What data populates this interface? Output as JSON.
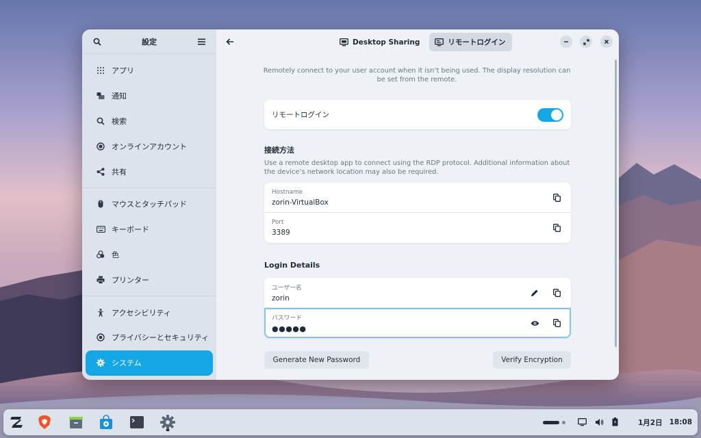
{
  "sidebar": {
    "title": "設定",
    "items": [
      {
        "label": "アプリ",
        "icon": "apps-grid-icon"
      },
      {
        "label": "通知",
        "icon": "notification-icon"
      },
      {
        "label": "検索",
        "icon": "search-icon"
      },
      {
        "label": "オンラインアカウント",
        "icon": "online-accounts-icon"
      },
      {
        "label": "共有",
        "icon": "share-icon"
      },
      {
        "label": "マウスとタッチパッド",
        "icon": "mouse-icon"
      },
      {
        "label": "キーボード",
        "icon": "keyboard-icon"
      },
      {
        "label": "色",
        "icon": "color-icon"
      },
      {
        "label": "プリンター",
        "icon": "printer-icon"
      },
      {
        "label": "アクセシビリティ",
        "icon": "accessibility-icon"
      },
      {
        "label": "プライバシーとセキュリティ",
        "icon": "privacy-icon"
      },
      {
        "label": "システム",
        "icon": "gear-icon",
        "active": true
      }
    ]
  },
  "header": {
    "tabs": [
      {
        "label": "Desktop Sharing",
        "icon": "desktop-sharing-icon"
      },
      {
        "label": "リモートログイン",
        "icon": "remote-login-icon",
        "active": true
      }
    ]
  },
  "main": {
    "description": "Remotely connect to your user account when it isn’t being used. The display resolution can be set from the remote.",
    "remote_login": {
      "label": "リモートログイン",
      "enabled": true
    },
    "connection": {
      "title": "接続方法",
      "description": "Use a remote desktop app to connect using the RDP protocol. Additional information about the device’s network location may also be required.",
      "hostname_label": "Hostname",
      "hostname": "zorin-VirtualBox",
      "port_label": "Port",
      "port": "3389"
    },
    "login": {
      "title": "Login Details",
      "username_label": "ユーザー名",
      "username": "zorin",
      "password_label": "パスワード",
      "password": "●●●●●"
    },
    "buttons": {
      "generate": "Generate New Password",
      "verify": "Verify Encryption"
    }
  },
  "taskbar": {
    "apps": [
      "zorin-menu-icon",
      "brave-browser-icon",
      "files-icon",
      "software-store-icon",
      "terminal-icon",
      "settings-icon"
    ],
    "date": "1月2日",
    "time": "18:08"
  },
  "colors": {
    "accent": "#15a6e6",
    "sidebar_bg": "#dde3ea",
    "main_bg": "#eef2f6"
  }
}
